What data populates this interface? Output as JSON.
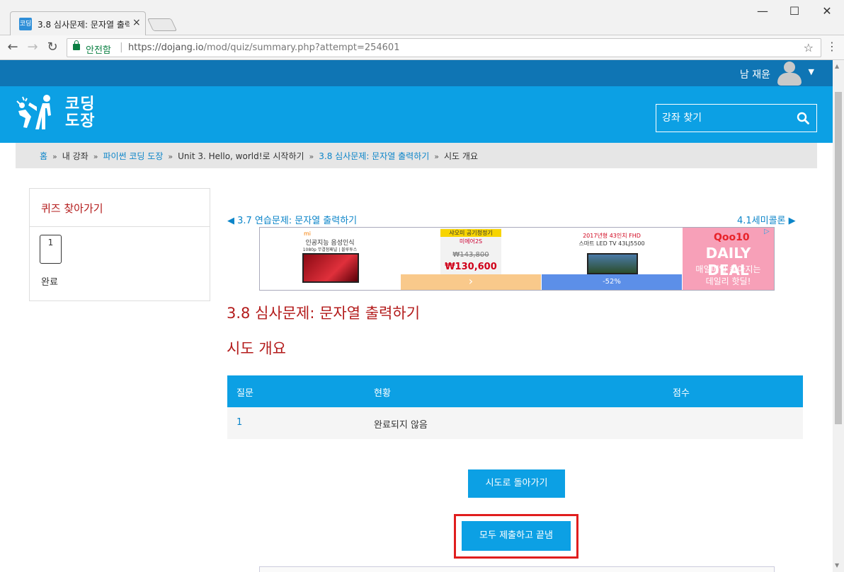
{
  "browser": {
    "tab_title": "3.8 심사문제: 문자열 출력",
    "tab_close": "×",
    "secure_label": "안전함",
    "url_host": "https://dojang.io",
    "url_path": "/mod/quiz/summary.php?attempt=254601",
    "window_minimize": "—",
    "window_maximize": "☐",
    "window_close": "✕"
  },
  "site": {
    "user_name": "남 재윤",
    "logo_text_line1": "코딩",
    "logo_text_line2": "도장",
    "search_placeholder": "강좌 찾기"
  },
  "breadcrumb": [
    {
      "label": "홈",
      "link": true
    },
    {
      "label": "내 강좌",
      "link": false
    },
    {
      "label": "파이썬 코딩 도장",
      "link": true
    },
    {
      "label": "Unit 3. Hello, world!로 시작하기",
      "link": false
    },
    {
      "label": "3.8 심사문제: 문자열 출력하기",
      "link": true
    },
    {
      "label": "시도 개요",
      "link": false
    }
  ],
  "breadcrumb_sep": "»",
  "quiz_nav": {
    "title": "퀴즈 찾아가기",
    "question_number": "1",
    "status": "완료"
  },
  "activity_nav": {
    "prev": "◀ 3.7 연습문제: 문자열 출력하기",
    "next": "4.1세미콜론 ▶"
  },
  "ad": {
    "cell1_brand": "mi",
    "cell1_text": "인공지능 음성인식",
    "cell1_sub": "1080p 무결점패널 | 블루투스",
    "cell2_top": "샤오미 공기청정기",
    "cell2_model": "미에어2S",
    "cell2_old_price": "₩143,800",
    "cell2_price": "₩130,600",
    "cell2_arrow": "›",
    "cell3_top": "2017년형 43인치 FHD",
    "cell3_sub": "스마트 LED TV 43LJ5500",
    "cell3_discount": "-52%",
    "cell4_brand": "Qoo10",
    "cell4_deal": "DAILY DEAL",
    "cell4_line1": "매일매일 쏟아지는",
    "cell4_line2": "데일리 핫딜!"
  },
  "page_heading": "3.8 심사문제: 문자열 출력하기",
  "section_heading": "시도 개요",
  "table": {
    "headers": {
      "question": "질문",
      "status": "현황",
      "score": "점수"
    },
    "rows": [
      {
        "question": "1",
        "status": "완료되지 않음",
        "score": ""
      }
    ]
  },
  "buttons": {
    "return_attempt": "시도로 돌아가기",
    "submit_all": "모두 제출하고 끝냄"
  },
  "colors": {
    "brand_blue": "#0ca0e4",
    "topbar_blue": "#0f75b4",
    "heading_red": "#b31b1b",
    "highlight_red": "#e01e1e"
  }
}
